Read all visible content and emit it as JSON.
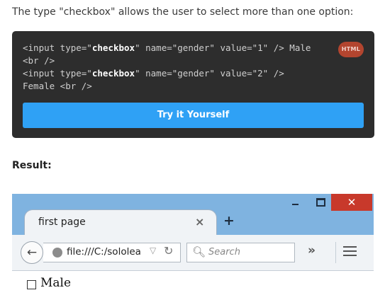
{
  "intro_text": "The type \"checkbox\" allows the user to select more than one option:",
  "code": {
    "lines": [
      [
        "<input type=\"",
        "checkbox",
        "\" name=\"gender\" value=\"1\" /> Male"
      ],
      [
        "<br />"
      ],
      [
        "<input type=\"",
        "checkbox",
        "\" name=\"gender\" value=\"2\" />"
      ],
      [
        "Female <br />"
      ]
    ],
    "language_badge": "HTML",
    "try_button": "Try it Yourself"
  },
  "result_label": "Result:",
  "browser": {
    "tab_title": "first page",
    "tab_close": "×",
    "new_tab": "+",
    "close_glyph": "✕",
    "url": "file:///C:/sololea",
    "search_placeholder": "Search",
    "overflow": "»",
    "page_checkbox_label": "Male"
  },
  "colors": {
    "code_bg": "#2d2d2d",
    "badge_bg": "#b3452f",
    "button_bg": "#2fa1f5",
    "browser_frame": "#7fb3e0",
    "close_bg": "#c8392b"
  }
}
